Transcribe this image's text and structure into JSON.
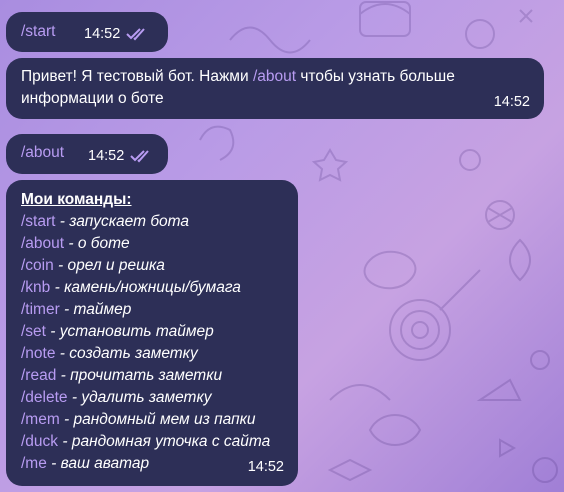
{
  "messages": {
    "start_cmd": {
      "text": "/start",
      "time": "14:52"
    },
    "greeting": {
      "text_before": "Привет! Я тестовый бот. Нажми ",
      "cmd": "/about",
      "text_after": " чтобы узнать больше информации о боте",
      "time": "14:52"
    },
    "about_cmd": {
      "text": "/about",
      "time": "14:52"
    },
    "commands": {
      "title": "Мои команды:",
      "time": "14:52",
      "items": [
        {
          "cmd": "/start",
          "desc": " - запускает бота"
        },
        {
          "cmd": "/about",
          "desc": " - о боте"
        },
        {
          "cmd": "/coin",
          "desc": " - орел и решка"
        },
        {
          "cmd": "/knb",
          "desc": " - камень/ножницы/бумага"
        },
        {
          "cmd": "/timer",
          "desc": " - таймер"
        },
        {
          "cmd": "/set",
          "desc": " - установить таймер"
        },
        {
          "cmd": "/note",
          "desc": " - создать заметку"
        },
        {
          "cmd": "/read",
          "desc": " - прочитать заметки"
        },
        {
          "cmd": "/delete",
          "desc": " - удалить заметку"
        },
        {
          "cmd": "/mem",
          "desc": " - рандомный мем из папки"
        },
        {
          "cmd": "/duck",
          "desc": " - рандомная уточка с сайта"
        },
        {
          "cmd": "/me",
          "desc": " - ваш аватар"
        }
      ]
    }
  },
  "colors": {
    "bubble": "#2d2f57",
    "command_link": "#b89cf2",
    "read_checks": "#b89cf2"
  },
  "icons": {
    "read_status": "double-check-icon"
  }
}
